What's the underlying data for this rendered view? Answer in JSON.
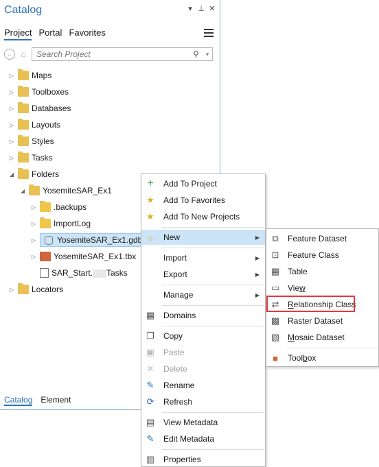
{
  "pane": {
    "title": "Catalog",
    "tabs": [
      "Project",
      "Portal",
      "Favorites"
    ],
    "search_placeholder": "Search Project",
    "tree": [
      {
        "label": "Maps"
      },
      {
        "label": "Toolboxes"
      },
      {
        "label": "Databases"
      },
      {
        "label": "Layouts"
      },
      {
        "label": "Styles"
      },
      {
        "label": "Tasks"
      },
      {
        "label": "Folders"
      },
      {
        "label": "YosemiteSAR_Ex1"
      },
      {
        "label": ".backups"
      },
      {
        "label": "ImportLog"
      },
      {
        "label": "YosemiteSAR_Ex1.gdb"
      },
      {
        "label": "YosemiteSAR_Ex1.tbx"
      },
      {
        "label_a": "SAR_Start.",
        "label_b": "Tasks"
      },
      {
        "label": "Locators"
      }
    ],
    "bottom_tabs": [
      "Catalog",
      "Element"
    ]
  },
  "context_menu": {
    "items": [
      {
        "label": "Add To Project"
      },
      {
        "label": "Add To Favorites"
      },
      {
        "label": "Add To New Projects"
      },
      {
        "label": "New"
      },
      {
        "label": "Import"
      },
      {
        "label": "Export"
      },
      {
        "label": "Manage"
      },
      {
        "label": "Domains"
      },
      {
        "label": "Copy"
      },
      {
        "label": "Paste"
      },
      {
        "label": "Delete"
      },
      {
        "label": "Rename"
      },
      {
        "label": "Refresh"
      },
      {
        "label": "View Metadata"
      },
      {
        "label": "Edit Metadata"
      },
      {
        "label": "Properties"
      }
    ]
  },
  "new_submenu": {
    "items": [
      {
        "label": "Feature Dataset"
      },
      {
        "label": "Feature Class"
      },
      {
        "label": "Table"
      },
      {
        "label_pre": "Vie",
        "label_u": "w",
        "label_post": ""
      },
      {
        "label_pre": "",
        "label_u": "R",
        "label_post": "elationship Class"
      },
      {
        "label": "Raster Dataset"
      },
      {
        "label_pre": "",
        "label_u": "M",
        "label_post": "osaic Dataset"
      },
      {
        "label_pre": "Tool",
        "label_u": "b",
        "label_post": "ox"
      }
    ]
  },
  "colors": {
    "accent": "#2d73b8",
    "highlight": "#cce4f7",
    "callout": "#e0393e"
  }
}
